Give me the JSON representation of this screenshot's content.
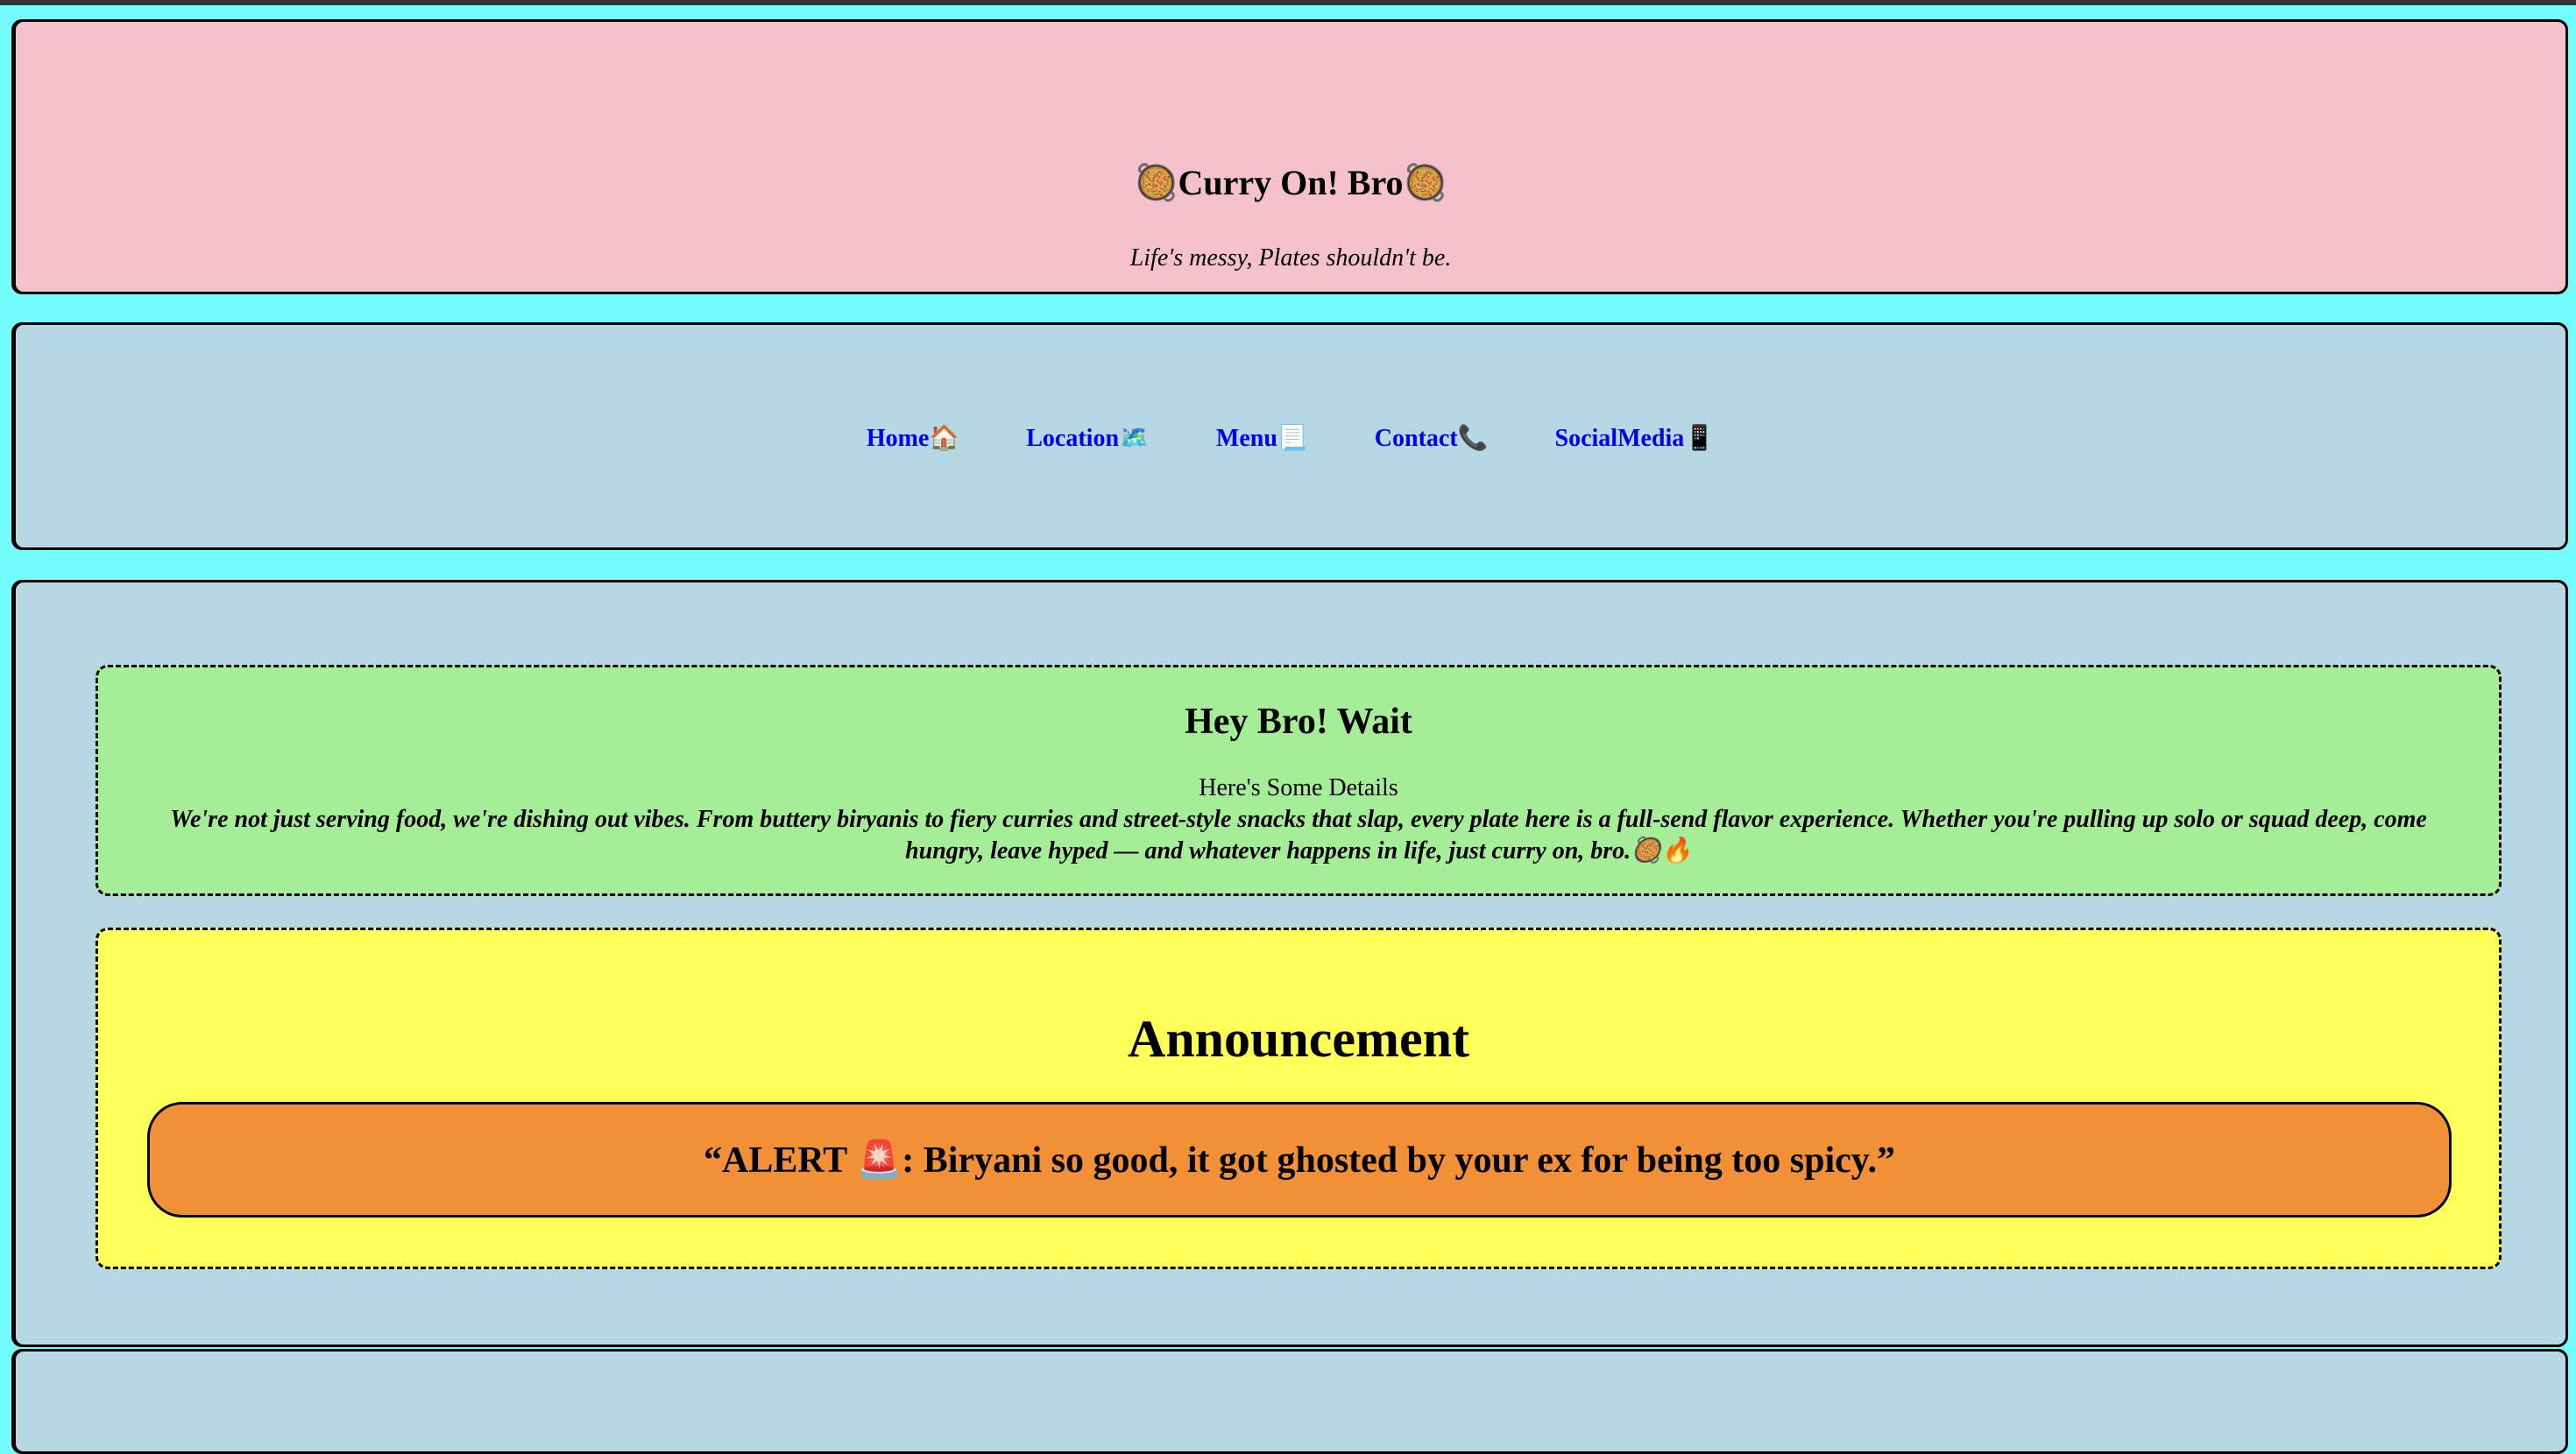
{
  "header": {
    "title": "🥘Curry On! Bro🥘",
    "tagline": "Life's messy, Plates shouldn't be."
  },
  "nav": {
    "items": [
      {
        "label": "Home🏠"
      },
      {
        "label": "Location🗺️"
      },
      {
        "label": "Menu📃"
      },
      {
        "label": "Contact📞"
      },
      {
        "label": "SocialMedia📱"
      }
    ]
  },
  "intro": {
    "heading": "Hey Bro! Wait",
    "subheading": "Here's Some Details",
    "text": "We're not just serving food, we're dishing out vibes. From buttery biryanis to fiery curries and street-style snacks that slap, every plate here is a full-send flavor experience. Whether you're pulling up solo or squad deep, come hungry, leave hyped — and whatever happens in life, just curry on, bro.🥘🔥"
  },
  "announcement": {
    "title": "Announcement",
    "alert": "“ALERT 🚨: Biryani so good, it got ghosted by your ex for being too spicy.”"
  },
  "colors": {
    "page_background": "#74fdfd",
    "header_background": "#f5c2cc",
    "section_background": "#b5d8e4",
    "intro_background": "#a6ed97",
    "announcement_background": "#ffff59",
    "alert_background": "#f29038",
    "link_color": "#0000ee"
  }
}
